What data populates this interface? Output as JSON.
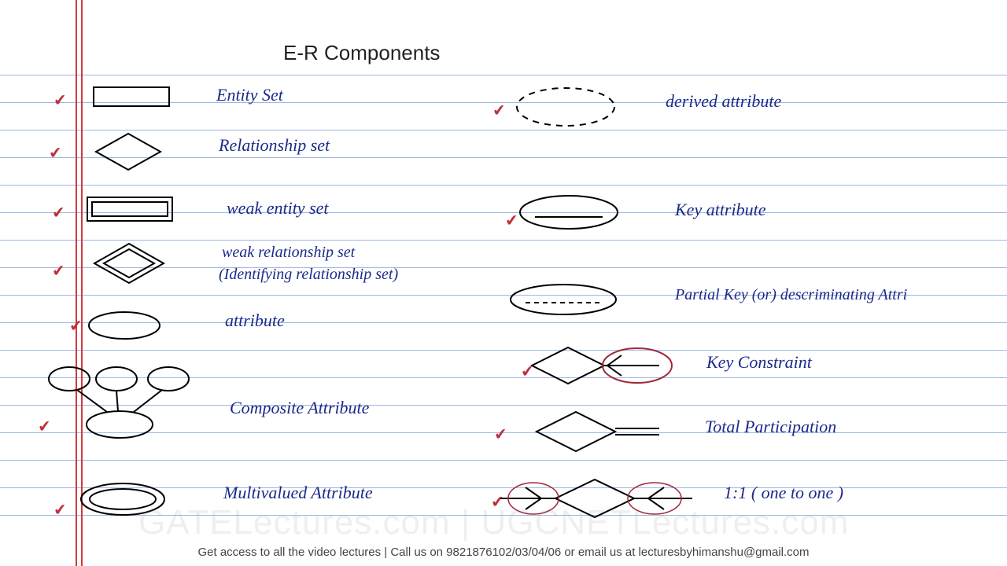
{
  "title": "E-R Components",
  "left_column": [
    {
      "label": "Entity Set"
    },
    {
      "label": "Relationship set"
    },
    {
      "label": "weak entity set"
    },
    {
      "label": "weak relationship set",
      "sublabel": "(Identifying relationship set)"
    },
    {
      "label": "attribute"
    },
    {
      "label": "Composite Attribute"
    },
    {
      "label": "Multivalued Attribute"
    }
  ],
  "right_column": [
    {
      "label": "derived attribute"
    },
    {
      "label": "Key attribute"
    },
    {
      "label": "Partial Key (or) descriminating Attri"
    },
    {
      "label": "Key Constraint"
    },
    {
      "label": "Total Participation"
    },
    {
      "label": "1:1 ( one to one )"
    }
  ],
  "watermark": "GATELectures.com | UGCNETLectures.com",
  "footer": "Get access to all the video lectures | Call us on 9821876102/03/04/06 or email us at lecturesbyhimanshu@gmail.com"
}
